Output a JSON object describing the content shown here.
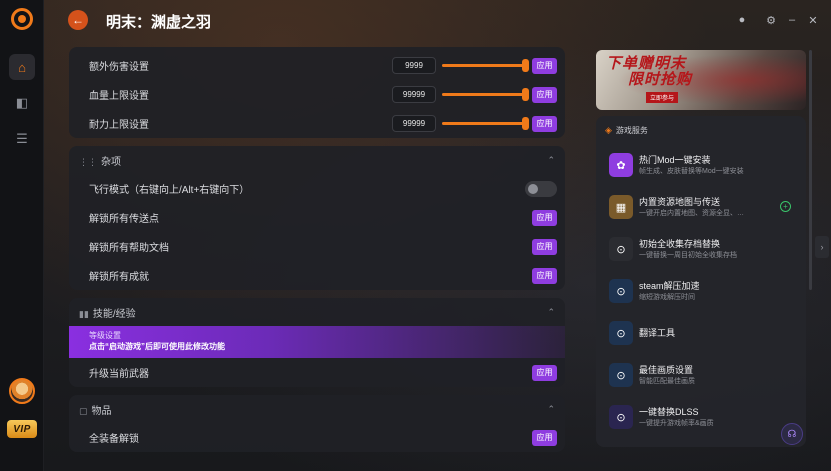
{
  "window": {
    "title": "明末：渊虚之羽"
  },
  "rail": {
    "vip_label": "VIP"
  },
  "attributes": [
    {
      "label": "额外伤害设置",
      "value": "9999",
      "progress": 1.0
    },
    {
      "label": "血量上限设置",
      "value": "99999",
      "progress": 1.0
    },
    {
      "label": "耐力上限设置",
      "value": "99999",
      "progress": 1.0
    }
  ],
  "apply_label": "应用",
  "misc": {
    "title": "杂项",
    "items": [
      {
        "label": "飞行模式（右键向上/Alt+右键向下）",
        "type": "toggle",
        "on": false
      },
      {
        "label": "解锁所有传送点",
        "type": "apply"
      },
      {
        "label": "解锁所有帮助文档",
        "type": "apply"
      },
      {
        "label": "解锁所有成就",
        "type": "apply"
      }
    ]
  },
  "skills": {
    "title": "技能/经验",
    "notice_title": "等级设置",
    "notice_text": "点击“启动游戏”后即可使用此修改功能",
    "items": [
      {
        "label": "升级当前武器",
        "type": "apply"
      }
    ]
  },
  "goods": {
    "title": "物品",
    "items": [
      {
        "label": "全装备解锁",
        "type": "apply"
      }
    ]
  },
  "banner": {
    "headline_1": "下单赠明末",
    "headline_2": "限时抢购",
    "sub": "立即参与"
  },
  "services": {
    "title": "游戏服务",
    "items": [
      {
        "title": "热门Mod一键安装",
        "desc": "帧生成、皮肤替换等Mod一键安装",
        "icon": "mod-icon",
        "color": "#8f3de0"
      },
      {
        "title": "内置资源地图与传送",
        "desc": "一键开启内置地图、资源全显、…",
        "icon": "map-icon",
        "color": "#7a5a2a",
        "has_plus": true
      },
      {
        "title": "初始全收集存档替换",
        "desc": "一键替换一周目初始全收集存档",
        "icon": "save-icon",
        "color": "#2b2c31"
      },
      {
        "title": "steam解压加速",
        "desc": "缩短游戏解压时间",
        "icon": "steam-icon",
        "color": "#1e3350"
      },
      {
        "title": "翻译工具",
        "desc": "",
        "icon": "translate-icon",
        "color": "#1e3350"
      },
      {
        "title": "最佳画质设置",
        "desc": "智能匹配最佳画质",
        "icon": "quality-icon",
        "color": "#1e3350"
      },
      {
        "title": "一键替换DLSS",
        "desc": "一键提升游戏帧率&画质",
        "icon": "dlss-icon",
        "color": "#2a2550"
      }
    ]
  },
  "colors": {
    "accent": "#f07a1a",
    "apply": "#8f3de0",
    "toggle_off": "#3a3b40"
  }
}
